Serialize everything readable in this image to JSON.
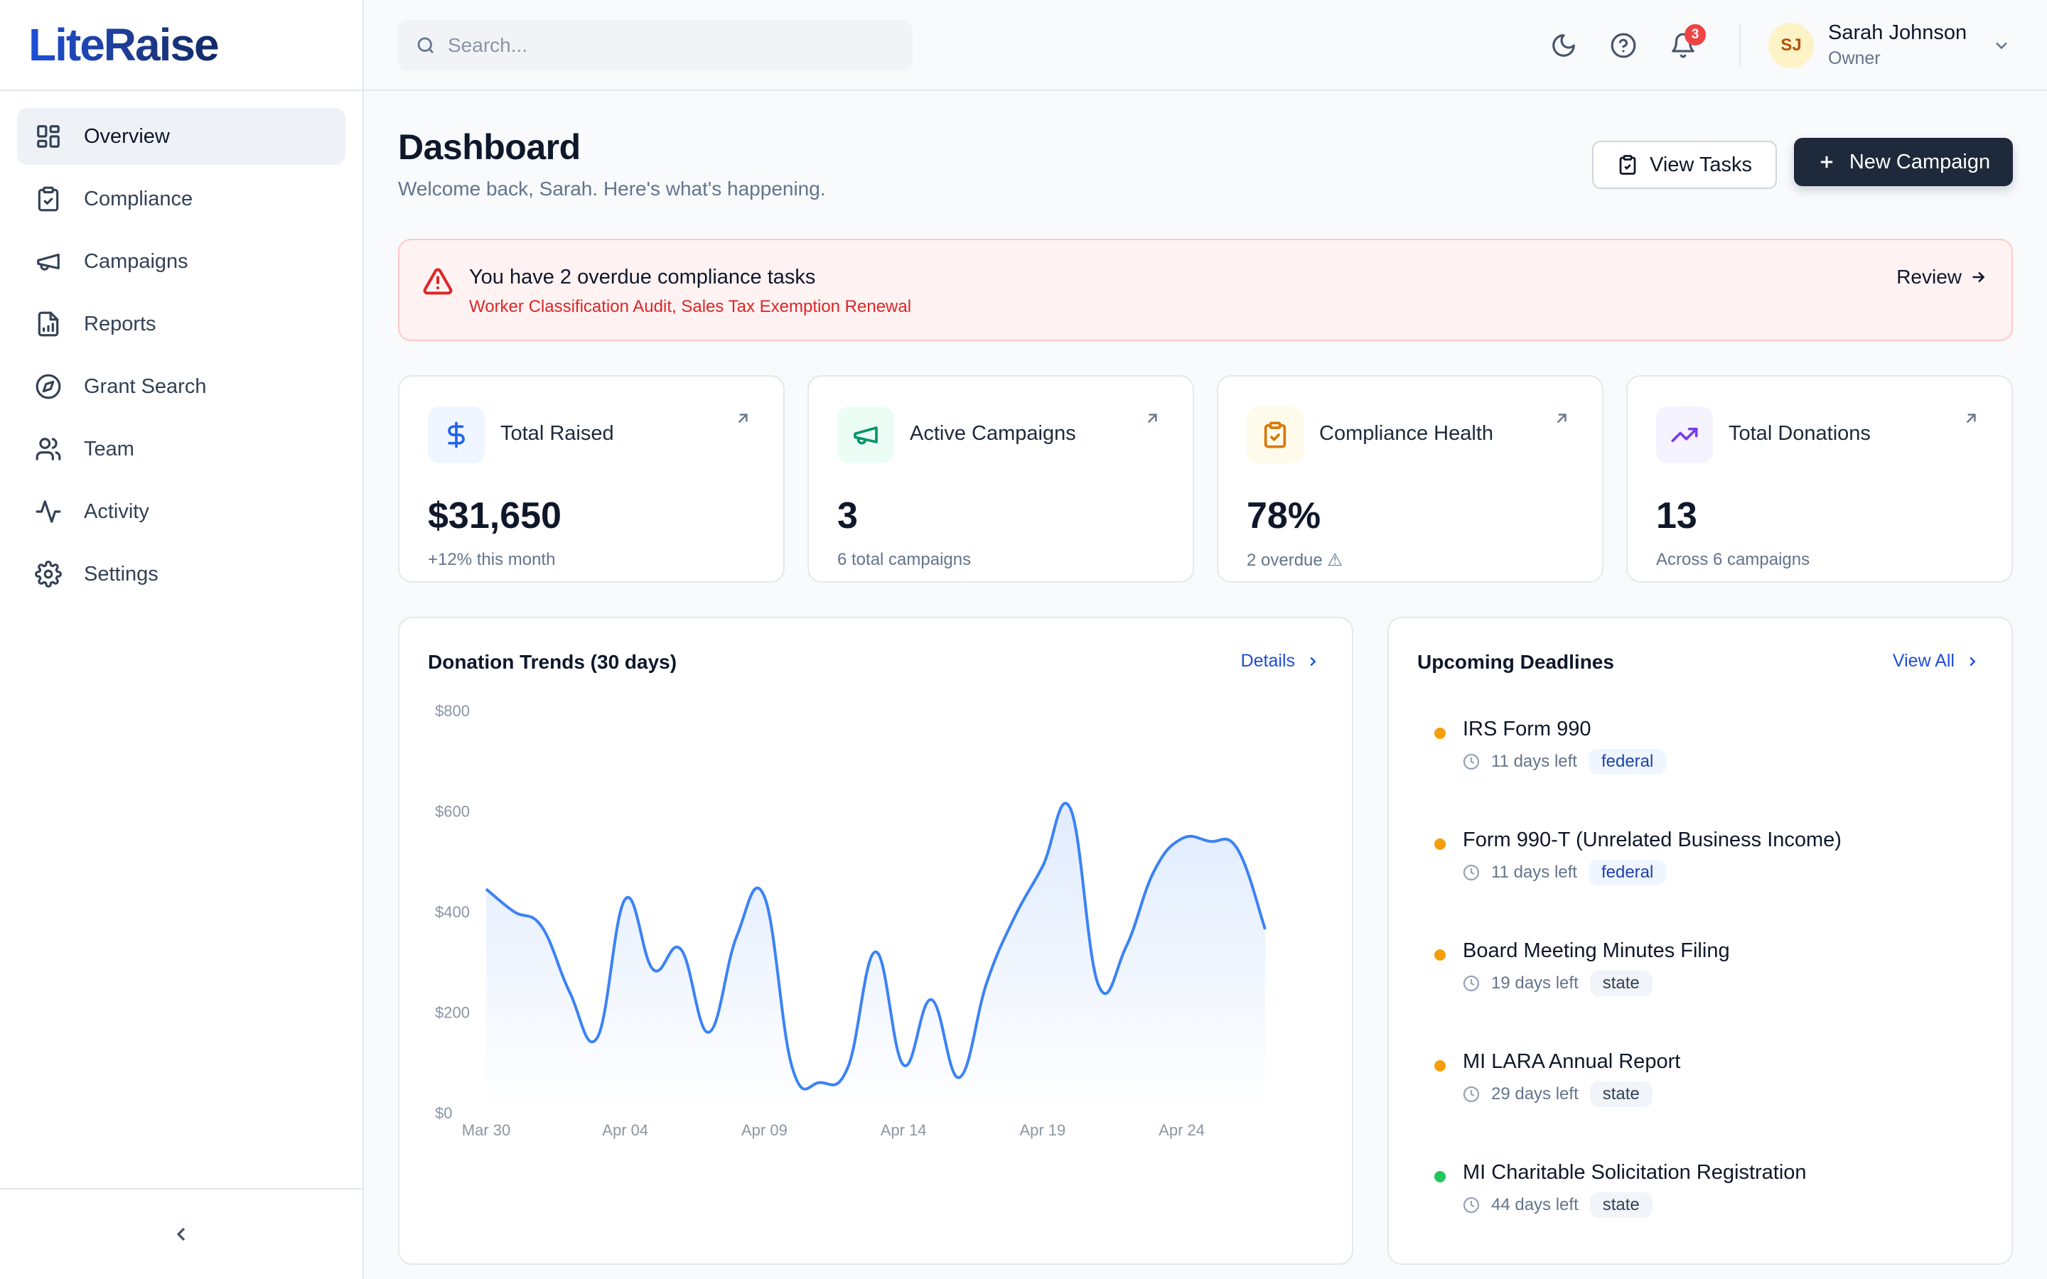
{
  "brand": {
    "name": "LiteRaise"
  },
  "sidebar": {
    "items": [
      {
        "label": "Overview",
        "icon": "grid-icon",
        "active": true
      },
      {
        "label": "Compliance",
        "icon": "clipboard-check-icon",
        "active": false
      },
      {
        "label": "Campaigns",
        "icon": "megaphone-icon",
        "active": false
      },
      {
        "label": "Reports",
        "icon": "report-icon",
        "active": false
      },
      {
        "label": "Grant Search",
        "icon": "compass-icon",
        "active": false
      },
      {
        "label": "Team",
        "icon": "users-icon",
        "active": false
      },
      {
        "label": "Activity",
        "icon": "activity-icon",
        "active": false
      },
      {
        "label": "Settings",
        "icon": "gear-icon",
        "active": false
      }
    ]
  },
  "topbar": {
    "search_placeholder": "Search...",
    "notification_count": "3",
    "user": {
      "initials": "SJ",
      "name": "Sarah Johnson",
      "role": "Owner"
    }
  },
  "header": {
    "title": "Dashboard",
    "subtitle": "Welcome back, Sarah. Here's what's happening.",
    "view_tasks_label": "View Tasks",
    "new_campaign_label": "New Campaign"
  },
  "alert": {
    "title": "You have 2 overdue compliance tasks",
    "detail": "Worker Classification Audit, Sales Tax Exemption Renewal",
    "action_label": "Review"
  },
  "stats": [
    {
      "label": "Total Raised",
      "value": "$31,650",
      "sub": "+12% this month",
      "icon": "dollar-icon",
      "color": "#2563eb",
      "bg": "#eff6ff"
    },
    {
      "label": "Active Campaigns",
      "value": "3",
      "sub": "6 total campaigns",
      "icon": "megaphone-icon",
      "color": "#059669",
      "bg": "#ecfdf5"
    },
    {
      "label": "Compliance Health",
      "value": "78%",
      "sub": "2 overdue ⚠",
      "icon": "clipboard-check-icon",
      "color": "#d97706",
      "bg": "#fffbeb"
    },
    {
      "label": "Total Donations",
      "value": "13",
      "sub": "Across 6 campaigns",
      "icon": "trending-up-icon",
      "color": "#7c3aed",
      "bg": "#f5f3ff"
    }
  ],
  "trends": {
    "title": "Donation Trends (30 days)",
    "link_label": "Details"
  },
  "chart_data": {
    "type": "area",
    "title": "Donation Trends (30 days)",
    "x": [
      "Mar 30",
      "Mar 31",
      "Apr 01",
      "Apr 02",
      "Apr 03",
      "Apr 04",
      "Apr 05",
      "Apr 06",
      "Apr 07",
      "Apr 08",
      "Apr 09",
      "Apr 10",
      "Apr 11",
      "Apr 12",
      "Apr 13",
      "Apr 14",
      "Apr 15",
      "Apr 16",
      "Apr 17",
      "Apr 18",
      "Apr 19",
      "Apr 20",
      "Apr 21",
      "Apr 22",
      "Apr 23",
      "Apr 24",
      "Apr 25",
      "Apr 26",
      "Apr 27"
    ],
    "values": [
      445,
      400,
      370,
      240,
      150,
      425,
      285,
      325,
      160,
      350,
      430,
      90,
      60,
      90,
      320,
      95,
      225,
      70,
      260,
      390,
      490,
      605,
      255,
      330,
      480,
      545,
      540,
      525,
      365
    ],
    "x_ticks": [
      "Mar 30",
      "Apr 04",
      "Apr 09",
      "Apr 14",
      "Apr 19",
      "Apr 24"
    ],
    "y_ticks": [
      "$0",
      "$200",
      "$400",
      "$600",
      "$800"
    ],
    "ylim": [
      0,
      800
    ],
    "color": "#3b82f6",
    "grid": false
  },
  "deadlines": {
    "title": "Upcoming Deadlines",
    "link_label": "View All",
    "items": [
      {
        "title": "IRS Form 990",
        "days": "11 days left",
        "tag": "federal",
        "dot": "#f59e0b"
      },
      {
        "title": "Form 990-T (Unrelated Business Income)",
        "days": "11 days left",
        "tag": "federal",
        "dot": "#f59e0b"
      },
      {
        "title": "Board Meeting Minutes Filing",
        "days": "19 days left",
        "tag": "state",
        "dot": "#f59e0b"
      },
      {
        "title": "MI LARA Annual Report",
        "days": "29 days left",
        "tag": "state",
        "dot": "#f59e0b"
      },
      {
        "title": "MI Charitable Solicitation Registration",
        "days": "44 days left",
        "tag": "state",
        "dot": "#22c55e"
      }
    ]
  }
}
